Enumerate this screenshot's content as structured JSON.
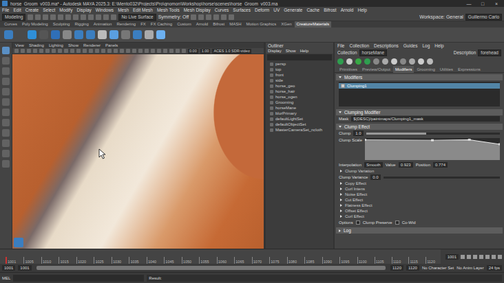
{
  "window": {
    "title": "horse_Groom_v003.ma* - Autodesk MAYA 2025.3: E:\\Mento032\\Projects\\Pro\\gnomon\\Workshop\\horse\\scenes\\horse_Groom_v003.ma",
    "controls": [
      "—",
      "□",
      "×"
    ]
  },
  "menubar": [
    "File",
    "Edit",
    "Create",
    "Select",
    "Modify",
    "Display",
    "Windows",
    "Mesh",
    "Edit Mesh",
    "Mesh Tools",
    "Mesh Display",
    "Curves",
    "Surfaces",
    "Deform",
    "UV",
    "Generate",
    "Cache",
    "Bifrost",
    "Arnold",
    "Help"
  ],
  "status_line": {
    "mode": "Modeling",
    "live": "No Live Surface",
    "symmetry": "Symmetry: Off",
    "user": "Guillermo Carlo",
    "workspace": "Workspace: General"
  },
  "shelf_tabs": [
    {
      "label": "Curves",
      "selected": false
    },
    {
      "label": "Poly Modeling",
      "selected": false
    },
    {
      "label": "Sculpting",
      "selected": false
    },
    {
      "label": "Rigging",
      "selected": false
    },
    {
      "label": "Animation",
      "selected": false
    },
    {
      "label": "Rendering",
      "selected": false
    },
    {
      "label": "FX",
      "selected": false
    },
    {
      "label": "FX Caching",
      "selected": false
    },
    {
      "label": "Custom",
      "selected": false
    },
    {
      "label": "Arnold",
      "selected": false
    },
    {
      "label": "Bifrost",
      "selected": false
    },
    {
      "label": "MASH",
      "selected": false
    },
    {
      "label": "Motion Graphics",
      "selected": false
    },
    {
      "label": "XGen",
      "selected": false
    },
    {
      "label": "CreatureMaterials",
      "selected": true
    }
  ],
  "viewport": {
    "menu": [
      "View",
      "Shading",
      "Lighting",
      "Show",
      "Renderer",
      "Panels"
    ],
    "fields": [
      "0.00",
      "1.00"
    ],
    "color_space": "ACES 1.0 SDR-video"
  },
  "outliner": {
    "title": "Outliner",
    "menu": [
      "Display",
      "Show",
      "Help"
    ],
    "items": [
      {
        "label": "persp",
        "selected": false
      },
      {
        "label": "top",
        "selected": false
      },
      {
        "label": "front",
        "selected": false
      },
      {
        "label": "side",
        "selected": false
      },
      {
        "label": "horse_geo",
        "selected": false
      },
      {
        "label": "horse_hair",
        "selected": false
      },
      {
        "label": "horse_ogen",
        "selected": false
      },
      {
        "label": "Grooming",
        "selected": false
      },
      {
        "label": "horseMane",
        "selected": false
      },
      {
        "label": "blurPrimary",
        "selected": false
      },
      {
        "label": "defaultLightSet",
        "selected": false
      },
      {
        "label": "defaultObjectSet",
        "selected": false
      },
      {
        "label": "MasterCameraSet_ncloth",
        "selected": false
      }
    ]
  },
  "xgen": {
    "menu": [
      "File",
      "Collection",
      "Descriptions",
      "Guides",
      "Log",
      "Help"
    ],
    "collection_label": "Collection",
    "collection": "horseMane",
    "description_label": "Description",
    "description": "forehead",
    "tabs": [
      {
        "label": "Primitives",
        "selected": false
      },
      {
        "label": "Preview/Output",
        "selected": false
      },
      {
        "label": "Modifiers",
        "selected": true
      },
      {
        "label": "Grooming",
        "selected": false
      },
      {
        "label": "Utilities",
        "selected": false
      },
      {
        "label": "Expressions",
        "selected": false
      }
    ],
    "modifiers_header": "Modifiers",
    "modifiers": [
      {
        "label": "Clumping1",
        "selected": true,
        "checked": true
      }
    ],
    "section": "Clumping Modifier",
    "mask_label": "Mask",
    "mask": "${DESC}/paintmaps/Clumping1_mask",
    "clump_effect": "Clump Effect",
    "clump_label": "Clump",
    "clump_value": "1.0",
    "clump_level": 0.45,
    "clump_scale_label": "Clump Scale",
    "curve": [
      [
        0,
        0.92
      ],
      [
        0.5,
        0.9
      ],
      [
        0.774,
        0.923
      ],
      [
        1,
        0.72
      ]
    ],
    "interp_label": "Interpolation",
    "interp": "Smooth",
    "value_label": "Value",
    "value": "0.923",
    "position_label": "Position",
    "position": "0.774",
    "clump_variation": "Clump Variation",
    "variance_label": "Clump Variance",
    "variance": "0.0",
    "collapsed": [
      "Copy Effect",
      "Curl Intens",
      "Noise Effect",
      "Cut Effect",
      "Flatness Effect",
      "Offset Effect",
      "Curl Effect"
    ],
    "options_label": "Options",
    "options": [
      {
        "label": "Clump Preserve",
        "checked": false
      },
      {
        "label": "Co-Wid",
        "checked": false
      }
    ],
    "log": "Log"
  },
  "timeline": {
    "ticks": [
      "1001",
      "1005",
      "1010",
      "1015",
      "1020",
      "1025",
      "1030",
      "1035",
      "1040",
      "1045",
      "1050",
      "1055",
      "1060",
      "1065",
      "1070",
      "1075",
      "1080",
      "1085",
      "1090",
      "1095",
      "1100",
      "1105",
      "1110",
      "1115",
      "1120"
    ],
    "current_index": 0,
    "frame": "1001"
  },
  "range": {
    "start": "1001",
    "inner_start": "1001",
    "inner_end": "1120",
    "end": "1120",
    "character": "No Character Set",
    "anim_layer": "No Anim Layer",
    "fps": "24 fps"
  },
  "command": {
    "lang": "MEL",
    "result": "Result:"
  }
}
